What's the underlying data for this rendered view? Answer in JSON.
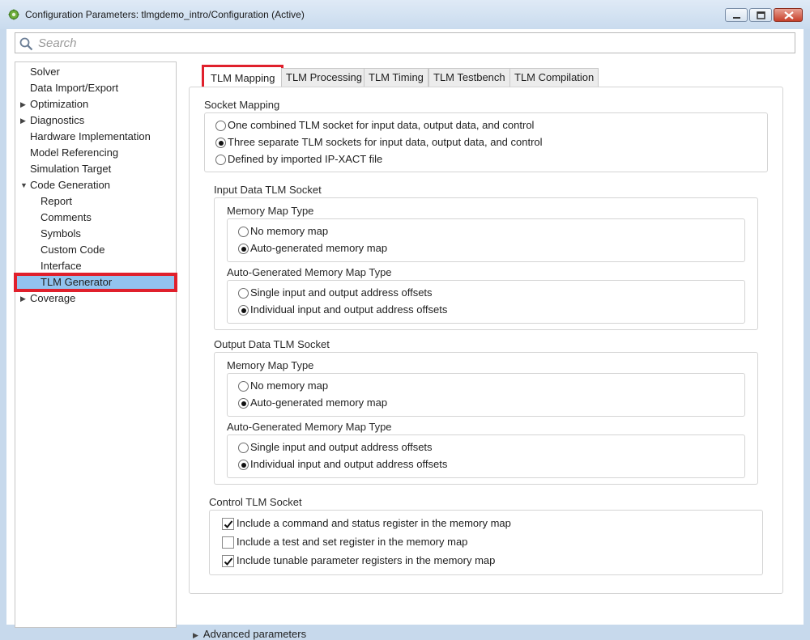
{
  "window": {
    "title": "Configuration Parameters: tlmgdemo_intro/Configuration (Active)",
    "app_icon": "gear-icon",
    "accent": "#e0202c",
    "selected_bg": "#92c3ef"
  },
  "search": {
    "placeholder": "Search",
    "value": ""
  },
  "tree": {
    "items": [
      {
        "label": "Solver"
      },
      {
        "label": "Data Import/Export"
      },
      {
        "label": "Optimization"
      },
      {
        "label": "Diagnostics"
      },
      {
        "label": "Hardware Implementation"
      },
      {
        "label": "Model Referencing"
      },
      {
        "label": "Simulation Target"
      },
      {
        "label": "Code Generation"
      },
      {
        "label": "Report"
      },
      {
        "label": "Comments"
      },
      {
        "label": "Symbols"
      },
      {
        "label": "Custom Code"
      },
      {
        "label": "Interface"
      },
      {
        "label": "TLM Generator"
      },
      {
        "label": "Coverage"
      }
    ]
  },
  "tabs": [
    {
      "label": "TLM Mapping"
    },
    {
      "label": "TLM Processing"
    },
    {
      "label": "TLM Timing"
    },
    {
      "label": "TLM Testbench"
    },
    {
      "label": "TLM Compilation"
    }
  ],
  "socket_mapping": {
    "title": "Socket Mapping",
    "options": [
      "One combined TLM socket for input data, output data, and control",
      "Three separate TLM sockets for input data, output data, and control",
      "Defined by imported IP-XACT file"
    ]
  },
  "input_socket": {
    "title": "Input Data TLM Socket",
    "mm_type_title": "Memory Map Type",
    "mm_options": [
      "No memory map",
      "Auto-generated memory map"
    ],
    "agmm_title": "Auto-Generated Memory Map Type",
    "agmm_options": [
      "Single input and output address offsets",
      "Individual input and output address offsets"
    ]
  },
  "output_socket": {
    "title": "Output Data TLM Socket",
    "mm_type_title": "Memory Map Type",
    "mm_options": [
      "No memory map",
      "Auto-generated memory map"
    ],
    "agmm_title": "Auto-Generated Memory Map Type",
    "agmm_options": [
      "Single input and output address offsets",
      "Individual input and output address offsets"
    ]
  },
  "control_socket": {
    "title": "Control TLM Socket",
    "options": [
      "Include a command and status register in the memory map",
      "Include a test and set register in the memory map",
      "Include tunable parameter registers in the memory map"
    ]
  },
  "advanced": {
    "label": "Advanced parameters"
  }
}
